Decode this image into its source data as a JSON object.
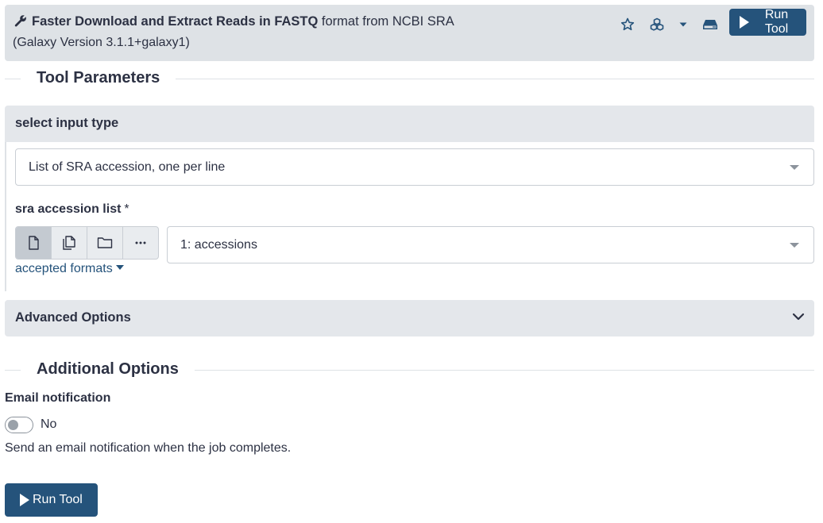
{
  "header": {
    "title_bold": "Faster Download and Extract Reads in FASTQ",
    "title_rest": " format from NCBI SRA",
    "version": "(Galaxy Version 3.1.1+galaxy1)",
    "run_label": "Run Tool",
    "icons": [
      "wrench-icon",
      "star-icon",
      "cubes-icon",
      "caret-down-icon",
      "hdd-icon",
      "play-icon"
    ]
  },
  "sections": {
    "tool_parameters": "Tool Parameters",
    "additional_options": "Additional Options"
  },
  "input_type": {
    "label": "select input type",
    "selected": "List of SRA accession, one per line"
  },
  "accession": {
    "label": "sra accession list",
    "required_mark": "*",
    "selected": "1: accessions",
    "accepted_formats": "accepted formats",
    "button_icons": [
      "file-icon",
      "files-icon",
      "folder-icon",
      "ellipsis-icon"
    ],
    "ellipsis_label": "..."
  },
  "advanced": {
    "label": "Advanced Options"
  },
  "email": {
    "label": "Email notification",
    "toggle_text": "No",
    "help": "Send an email notification when the job completes."
  },
  "footer": {
    "run_label": "Run Tool"
  },
  "colors": {
    "primary": "#25537b",
    "header_bg": "#dee2e6",
    "text": "#2c3143"
  }
}
